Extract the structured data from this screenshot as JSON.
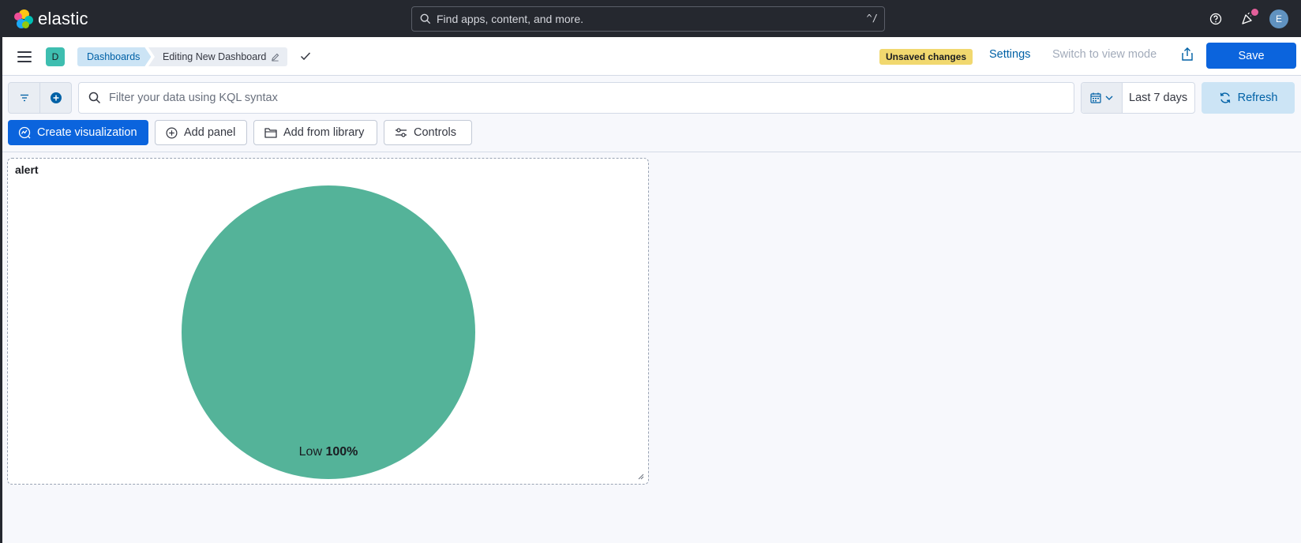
{
  "header": {
    "brand": "elastic",
    "search_placeholder": "Find apps, content, and more.",
    "search_shortcut": "^/",
    "user_initial": "E"
  },
  "nav": {
    "space_initial": "D",
    "breadcrumbs": [
      "Dashboards",
      "Editing New Dashboard"
    ],
    "unsaved_badge": "Unsaved changes",
    "settings_label": "Settings",
    "switch_mode_label": "Switch to view mode",
    "save_label": "Save"
  },
  "query": {
    "placeholder": "Filter your data using KQL syntax",
    "time_range": "Last 7 days",
    "refresh_label": "Refresh"
  },
  "toolbar": {
    "create_visualization": "Create visualization",
    "add_panel": "Add panel",
    "add_from_library": "Add from library",
    "controls": "Controls"
  },
  "panel": {
    "title": "alert"
  },
  "chart_data": {
    "type": "pie",
    "categories": [
      "Low"
    ],
    "values": [
      100
    ],
    "labels": [
      {
        "name": "Low",
        "value": "100%"
      }
    ],
    "colors": [
      "#54b399"
    ]
  },
  "colors": {
    "accent": "#0b64dd",
    "header_bg": "#25282f",
    "slice": "#54b399"
  }
}
